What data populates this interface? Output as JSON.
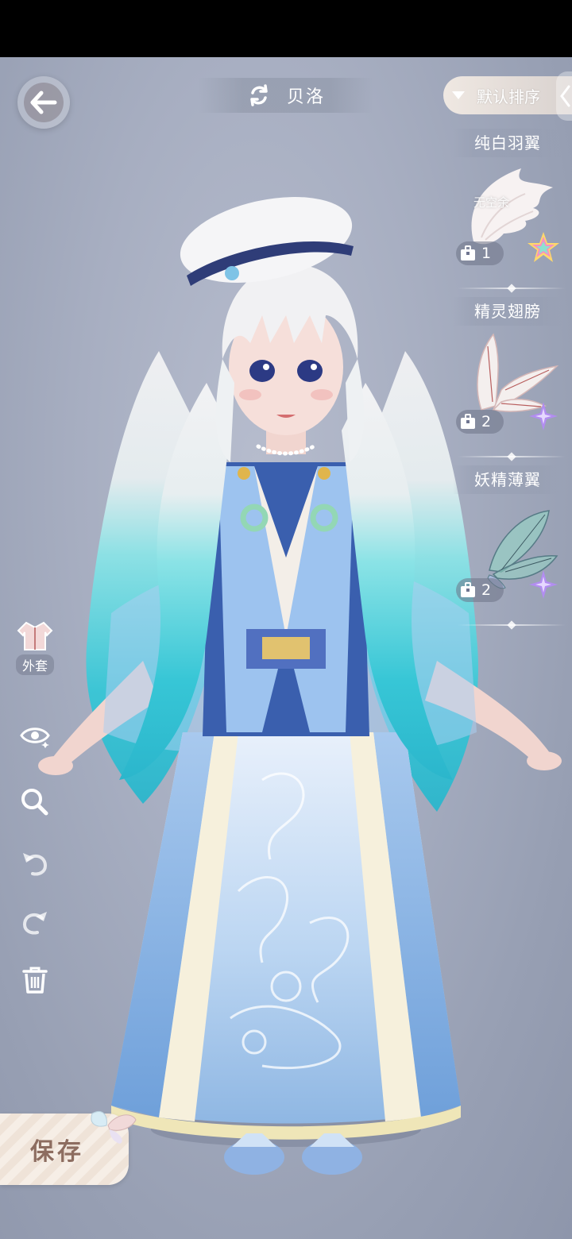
{
  "header": {
    "character_name": "贝洛",
    "sort_label": "默认排序"
  },
  "items": [
    {
      "name": "纯白羽翼",
      "owned_count": "1",
      "tag": "无空余",
      "rarity": "rainbow"
    },
    {
      "name": "精灵翅膀",
      "owned_count": "2",
      "tag": "",
      "rarity": "purple"
    },
    {
      "name": "妖精薄翼",
      "owned_count": "2",
      "tag": "",
      "rarity": "purple"
    }
  ],
  "tools": {
    "outerwear_label": "外套"
  },
  "save": {
    "label": "保存"
  },
  "colors": {
    "background": "#a7aec1",
    "hair_tip": "#5fd6dc",
    "dress_blue": "#8fb7e3",
    "purple_star": "#b28df0"
  }
}
